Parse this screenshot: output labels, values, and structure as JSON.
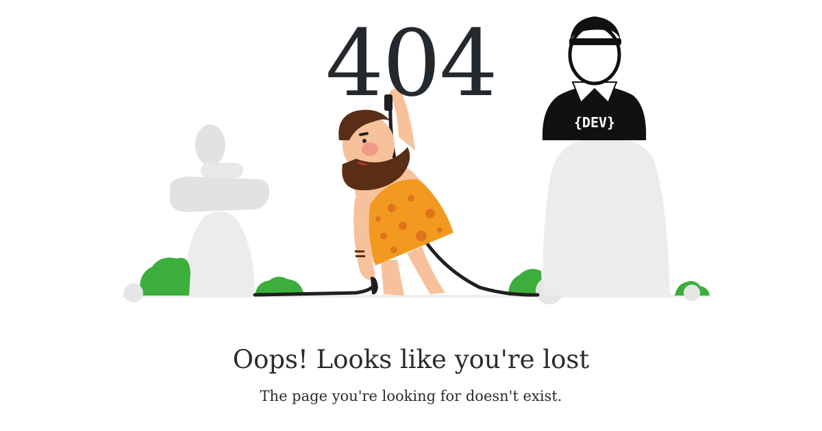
{
  "error": {
    "code": "404",
    "headline": "Oops! Looks like you're lost",
    "message": "The page you're looking for doesn't exist."
  },
  "badge": {
    "label": "{DEV}"
  },
  "illustration": {
    "icons": [
      "stone-cairn-icon",
      "bush-icon",
      "caveman-icon",
      "power-cable-icon",
      "plug-icon",
      "developer-avatar-icon",
      "rock-pillar-icon"
    ]
  },
  "colors": {
    "text": "#24292e",
    "stone": "#e6e6e6",
    "bush": "#3bae3b",
    "caveman_tunic": "#f29a1f",
    "caveman_skin": "#f7c29b",
    "beard": "#5a2e16",
    "cable": "#1f1f1f"
  }
}
